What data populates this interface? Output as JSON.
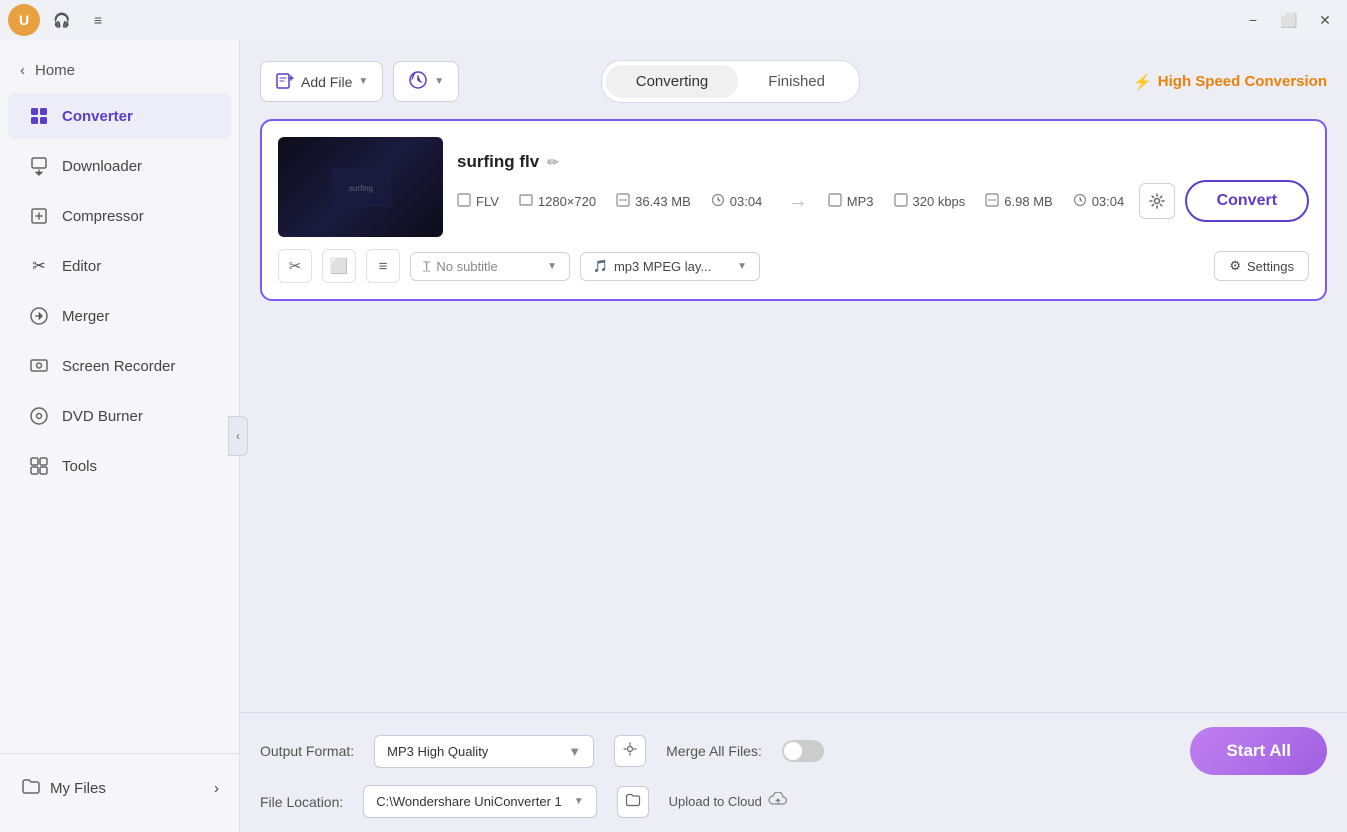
{
  "titlebar": {
    "user_icon": "U",
    "headphone_icon": "🎧",
    "menu_icon": "≡",
    "minimize": "−",
    "maximize": "⬜",
    "close": "✕"
  },
  "sidebar": {
    "home_label": "Home",
    "home_icon": "‹",
    "items": [
      {
        "id": "converter",
        "label": "Converter",
        "icon": "⊞",
        "active": true
      },
      {
        "id": "downloader",
        "label": "Downloader",
        "icon": "⬇"
      },
      {
        "id": "compressor",
        "label": "Compressor",
        "icon": "🗜"
      },
      {
        "id": "editor",
        "label": "Editor",
        "icon": "✂"
      },
      {
        "id": "merger",
        "label": "Merger",
        "icon": "⊕"
      },
      {
        "id": "screen-recorder",
        "label": "Screen Recorder",
        "icon": "⏺"
      },
      {
        "id": "dvd-burner",
        "label": "DVD Burner",
        "icon": "💿"
      },
      {
        "id": "tools",
        "label": "Tools",
        "icon": "⊞"
      }
    ],
    "my_files_label": "My Files",
    "my_files_icon": "📁",
    "my_files_chevron": "›"
  },
  "toolbar": {
    "add_file_label": "Add File",
    "add_file_icon": "📋",
    "add_url_icon": "🔗",
    "converting_label": "Converting",
    "finished_label": "Finished",
    "high_speed_label": "High Speed Conversion",
    "lightning_icon": "⚡"
  },
  "file_card": {
    "file_name": "surfing flv",
    "edit_icon": "✏",
    "source": {
      "format": "FLV",
      "resolution": "1280×720",
      "size": "36.43 MB",
      "duration": "03:04"
    },
    "output": {
      "format": "MP3",
      "bitrate": "320 kbps",
      "size": "6.98 MB",
      "duration": "03:04"
    },
    "convert_btn": "Convert",
    "settings_icon": "⚙",
    "subtitle_placeholder": "No subtitle",
    "audio_track": "mp3 MPEG lay...",
    "settings_btn": "Settings",
    "cut_icon": "✂",
    "crop_icon": "⬜",
    "more_icon": "≡"
  },
  "bottom_bar": {
    "output_format_label": "Output Format:",
    "output_format_value": "MP3 High Quality",
    "file_location_label": "File Location:",
    "file_location_value": "C:\\Wondershare UniConverter 1",
    "merge_label": "Merge All Files:",
    "upload_label": "Upload to Cloud",
    "start_btn": "Start All"
  },
  "colors": {
    "accent": "#5a3ec8",
    "orange": "#e8820c",
    "purple_light": "#c080f0"
  }
}
